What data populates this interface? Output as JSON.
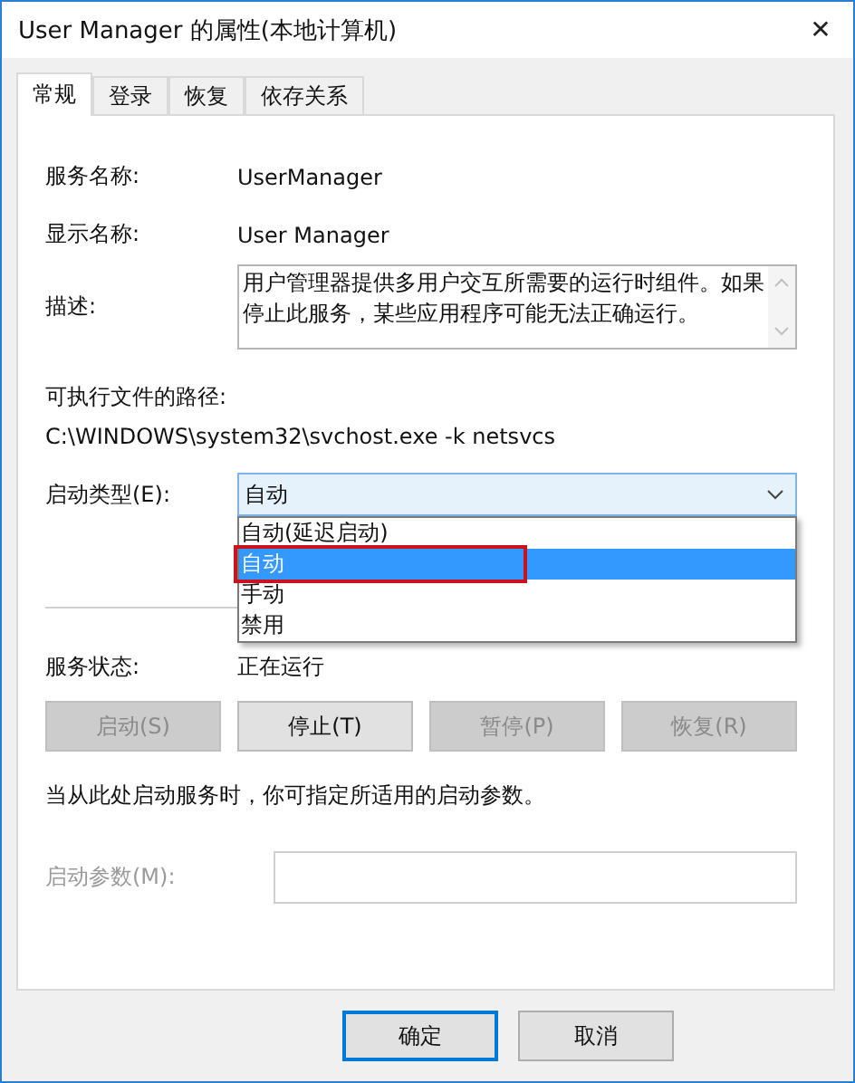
{
  "window": {
    "title": "User Manager 的属性(本地计算机)",
    "close": "✕"
  },
  "tabs": [
    {
      "label": "常规",
      "selected": true
    },
    {
      "label": "登录",
      "selected": false
    },
    {
      "label": "恢复",
      "selected": false
    },
    {
      "label": "依存关系",
      "selected": false
    }
  ],
  "service_name": {
    "label": "服务名称:",
    "value": "UserManager"
  },
  "display_name": {
    "label": "显示名称:",
    "value": "User Manager"
  },
  "description": {
    "label": "描述:",
    "text": "用户管理器提供多用户交互所需要的运行时组件。如果停止此服务，某些应用程序可能无法正确运行。"
  },
  "executable_path": {
    "label": "可执行文件的路径:",
    "value": "C:\\WINDOWS\\system32\\svchost.exe -k netsvcs"
  },
  "startup_type": {
    "label": "启动类型(E):",
    "value": "自动",
    "expanded": true,
    "options": [
      {
        "label": "自动(延迟启动)",
        "selected": false,
        "highlighted": false
      },
      {
        "label": "自动",
        "selected": true,
        "highlighted": true
      },
      {
        "label": "手动",
        "selected": false,
        "highlighted": false
      },
      {
        "label": "禁用",
        "selected": false,
        "highlighted": false
      }
    ]
  },
  "service_status": {
    "label": "服务状态:",
    "value": "正在运行"
  },
  "service_buttons": [
    {
      "label": "启动(S)",
      "disabled": true
    },
    {
      "label": "停止(T)",
      "disabled": false
    },
    {
      "label": "暂停(P)",
      "disabled": true
    },
    {
      "label": "恢复(R)",
      "disabled": true
    }
  ],
  "hint": "当从此处启动服务时，你可指定所适用的启动参数。",
  "start_parameters": {
    "label": "启动参数(M):",
    "disabled": true
  },
  "dialog_buttons": [
    {
      "label": "确定",
      "default": true
    },
    {
      "label": "取消",
      "default": false
    }
  ]
}
